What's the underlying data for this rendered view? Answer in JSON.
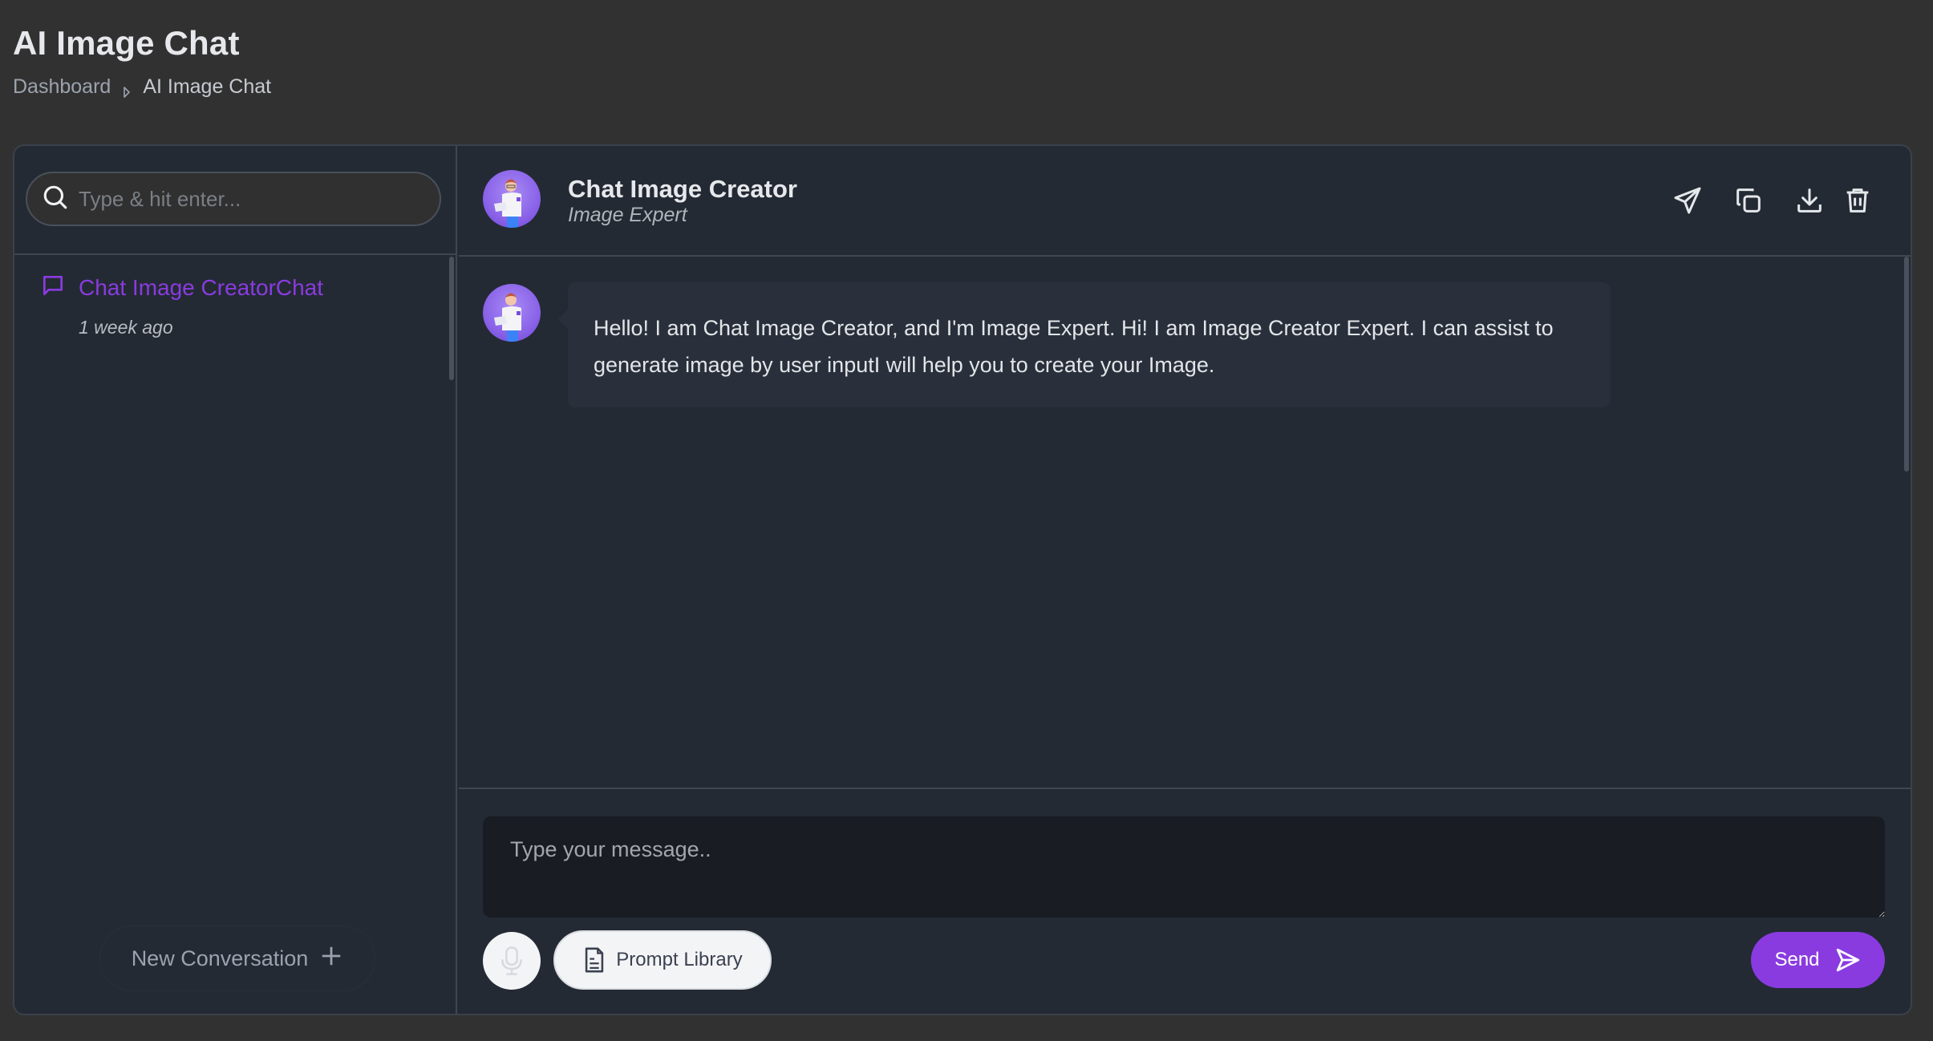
{
  "page": {
    "title": "AI Image Chat",
    "breadcrumb": [
      {
        "label": "Dashboard"
      },
      {
        "label": "AI Image Chat"
      }
    ]
  },
  "sidebar": {
    "search": {
      "placeholder": "Type & hit enter...",
      "value": "",
      "icon": "search-icon"
    },
    "conversations": [
      {
        "title": "Chat Image CreatorChat",
        "time": "1 week ago",
        "icon": "chat-bubble-icon",
        "active_color": "#8a3be0"
      }
    ],
    "new_conversation": {
      "label": "New Conversation",
      "icon": "plus-icon"
    }
  },
  "chat": {
    "bot": {
      "name": "Chat Image Creator",
      "role": "Image Expert",
      "avatar": "bot-avatar"
    },
    "actions": [
      {
        "name": "share",
        "icon": "send-icon"
      },
      {
        "name": "copy",
        "icon": "copy-icon"
      },
      {
        "name": "download",
        "icon": "download-icon"
      },
      {
        "name": "delete",
        "icon": "trash-icon"
      }
    ],
    "messages": [
      {
        "sender": "bot",
        "text": "Hello! I am Chat Image Creator, and I'm Image Expert. Hi! I am Image Creator Expert. I can assist to generate image by user inputI will help you to create your Image."
      }
    ],
    "composer": {
      "placeholder": "Type your message..",
      "value": "",
      "mic_icon": "microphone-icon",
      "prompt_library_label": "Prompt Library",
      "prompt_library_icon": "document-icon",
      "send_label": "Send",
      "send_icon": "send-icon"
    }
  },
  "colors": {
    "accent": "#8a3be0",
    "page_bg": "#313131",
    "panel_bg": "#232a34",
    "bubble_bg": "#29303b",
    "input_bg": "#191c22"
  }
}
